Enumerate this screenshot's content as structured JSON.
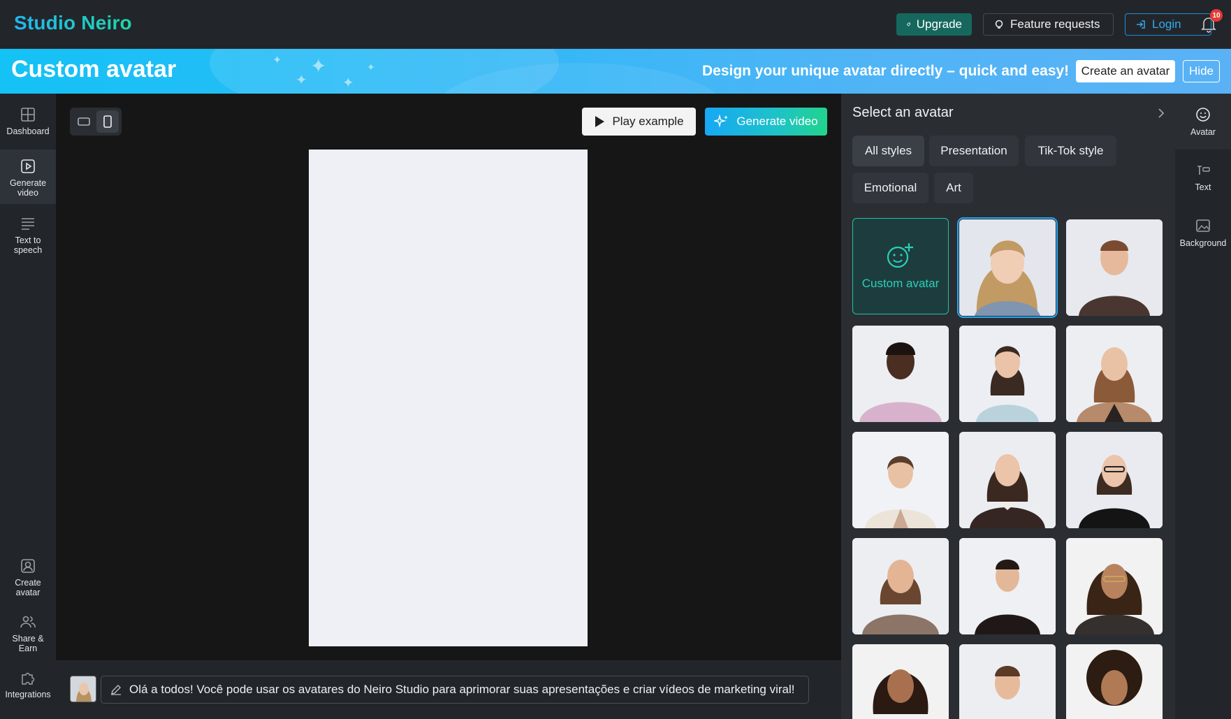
{
  "header": {
    "logo": "Studio Neiro",
    "upgrade_label": "Upgrade",
    "feature_requests_label": "Feature requests",
    "login_label": "Login",
    "notification_count": "10"
  },
  "banner": {
    "title": "Custom avatar",
    "tagline": "Design your unique avatar directly – quick and easy!",
    "create_label": "Create an avatar",
    "hide_label": "Hide"
  },
  "sidebar": {
    "top_items": [
      {
        "label": "Dashboard",
        "icon": "dashboard-icon"
      },
      {
        "label": "Generate video",
        "icon": "video-icon",
        "active": true
      },
      {
        "label": "Text to speech",
        "icon": "text-lines-icon"
      }
    ],
    "bottom_items": [
      {
        "label": "Create avatar",
        "icon": "user-square-icon"
      },
      {
        "label": "Share & Earn",
        "icon": "users-icon"
      },
      {
        "label": "Integrations",
        "icon": "puzzle-icon"
      }
    ]
  },
  "toolbar": {
    "play_example_label": "Play example",
    "generate_video_label": "Generate video"
  },
  "speech": {
    "text": "Olá a todos! Você pode usar os avatares do Neiro Studio para aprimorar suas apresentações e criar vídeos de marketing viral!"
  },
  "avatar_panel": {
    "title": "Select an avatar",
    "filters": [
      "All styles",
      "Presentation",
      "Tik-Tok style",
      "Emotional",
      "Art"
    ],
    "active_filter": "All styles",
    "custom_tile_label": "Custom avatar"
  },
  "tools": [
    {
      "label": "Avatar",
      "icon": "smiley-icon",
      "active": true
    },
    {
      "label": "Text",
      "icon": "text-tool-icon"
    },
    {
      "label": "Background",
      "icon": "image-icon"
    }
  ],
  "colors": {
    "accent_blue": "#23a6f2",
    "accent_teal": "#1fc4a0",
    "banner": "#32b8f7"
  }
}
